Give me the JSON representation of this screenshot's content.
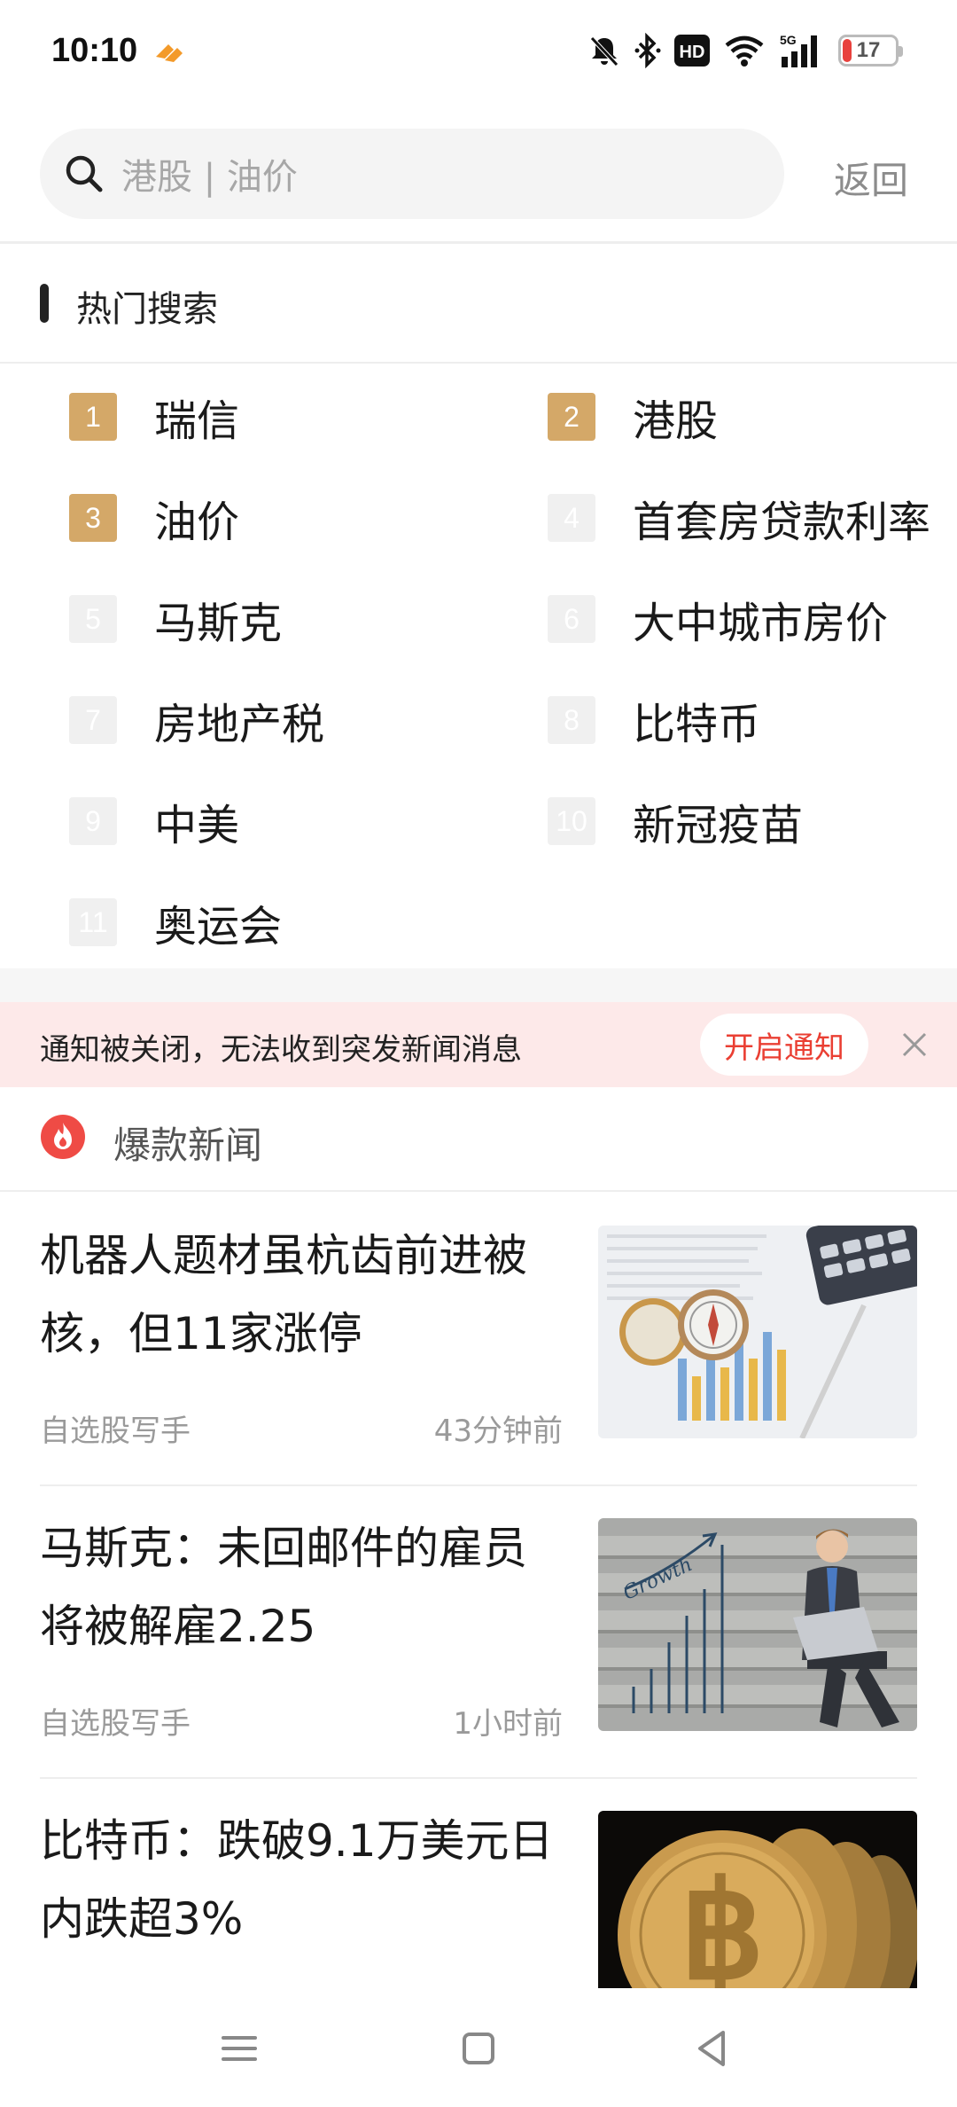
{
  "status_bar": {
    "time": "10:10",
    "battery_level": "17",
    "network": "5G",
    "hd_label": "HD",
    "icons": [
      "app-icon",
      "mute-bell-icon",
      "bluetooth-icon",
      "hd-icon",
      "wifi-icon",
      "signal-icon",
      "battery-icon"
    ]
  },
  "search": {
    "placeholder": "港股 | 油价",
    "back_label": "返回"
  },
  "hot_search": {
    "title": "热门搜索",
    "items": [
      {
        "rank": "1",
        "label": "瑞信"
      },
      {
        "rank": "2",
        "label": "港股"
      },
      {
        "rank": "3",
        "label": "油价"
      },
      {
        "rank": "4",
        "label": "首套房贷款利率"
      },
      {
        "rank": "5",
        "label": "马斯克"
      },
      {
        "rank": "6",
        "label": "大中城市房价"
      },
      {
        "rank": "7",
        "label": "房地产税"
      },
      {
        "rank": "8",
        "label": "比特币"
      },
      {
        "rank": "9",
        "label": "中美"
      },
      {
        "rank": "10",
        "label": "新冠疫苗"
      },
      {
        "rank": "11",
        "label": "奥运会"
      }
    ]
  },
  "notification": {
    "text": "通知被关闭，无法收到突发新闻消息",
    "button": "开启通知"
  },
  "hot_news": {
    "title": "爆款新闻",
    "articles": [
      {
        "title": "机器人题材虽杭齿前进被核，但11家涨停",
        "source": "自选股写手",
        "time": "43分钟前",
        "thumb": "compass-calculator-chart"
      },
      {
        "title": "马斯克：未回邮件的雇员将被解雇2.25",
        "source": "自选股写手",
        "time": "1小时前",
        "thumb": "businessman-growth-chart"
      },
      {
        "title": "比特币：跌破9.1万美元日内跌超3%",
        "source": "",
        "time": "",
        "thumb": "bitcoin-coins"
      }
    ]
  },
  "colors": {
    "rank_top": "#d4a868",
    "rank_other": "#f0f0f0",
    "notify_bg": "#fde9e9",
    "accent_red": "#ea3f33"
  }
}
